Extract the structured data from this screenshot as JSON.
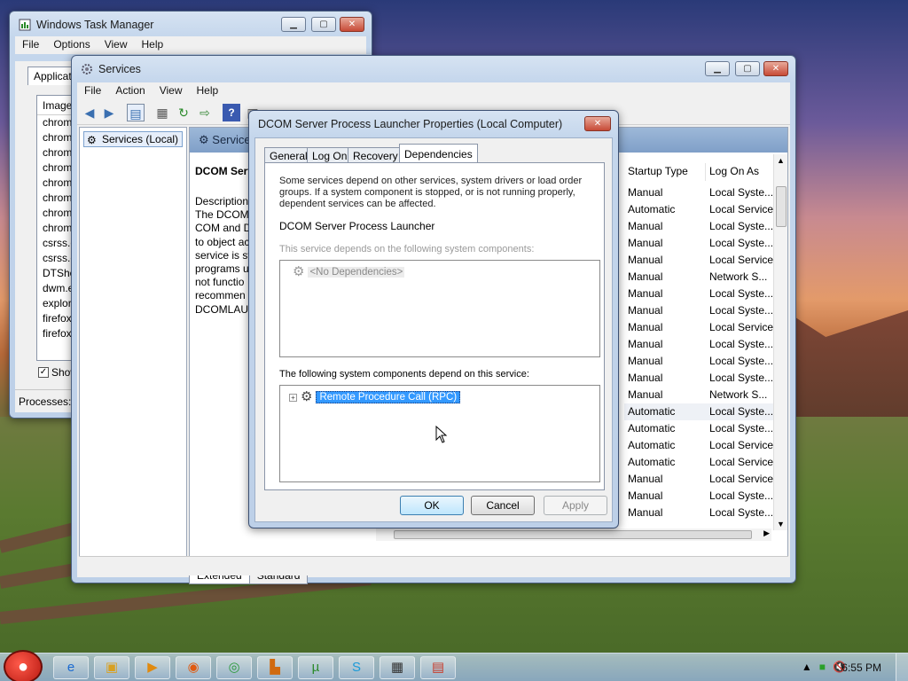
{
  "task_manager": {
    "title": "Windows Task Manager",
    "menu": [
      "File",
      "Options",
      "View",
      "Help"
    ],
    "tab": "Applicati",
    "column": "Image",
    "processes": [
      "chrome",
      "chrome",
      "chrome",
      "chrome",
      "chrome",
      "chrome",
      "chrome",
      "chrome",
      "csrss.e",
      "csrss.e",
      "DTShe",
      "dwm.e",
      "explor",
      "firefox",
      "firefox"
    ],
    "show_label": "Show",
    "status": "Processes: 6"
  },
  "services": {
    "title": "Services",
    "menu": [
      "File",
      "Action",
      "View",
      "Help"
    ],
    "tree_item": "Services (Local)",
    "pane_header": "Service",
    "desc_title": "DCOM Serv",
    "desc_lines": [
      "Description",
      "The DCOM",
      "COM and D",
      "to object ac",
      "service is st",
      "programs u",
      "not functio",
      "recommen",
      "DCOMLAU"
    ],
    "columns": {
      "startup": "Startup Type",
      "logon": "Log On As"
    },
    "rows": [
      {
        "startup": "Manual",
        "logon": "Local Syste..."
      },
      {
        "startup": "Automatic",
        "logon": "Local Service"
      },
      {
        "startup": "Manual",
        "logon": "Local Syste..."
      },
      {
        "startup": "Manual",
        "logon": "Local Syste..."
      },
      {
        "startup": "Manual",
        "logon": "Local Service"
      },
      {
        "startup": "Manual",
        "logon": "Network S..."
      },
      {
        "startup": "Manual",
        "logon": "Local Syste..."
      },
      {
        "startup": "Manual",
        "logon": "Local Syste..."
      },
      {
        "startup": "Manual",
        "logon": "Local Service"
      },
      {
        "startup": "Manual",
        "logon": "Local Syste..."
      },
      {
        "startup": "Manual",
        "logon": "Local Syste..."
      },
      {
        "startup": "Manual",
        "logon": "Local Syste..."
      },
      {
        "startup": "Manual",
        "logon": "Network S..."
      },
      {
        "startup": "Automatic",
        "logon": "Local Syste..."
      },
      {
        "startup": "Automatic",
        "logon": "Local Syste..."
      },
      {
        "startup": "Automatic",
        "logon": "Local Service"
      },
      {
        "startup": "Automatic",
        "logon": "Local Service"
      },
      {
        "startup": "Manual",
        "logon": "Local Service"
      },
      {
        "startup": "Manual",
        "logon": "Local Syste..."
      },
      {
        "startup": "Manual",
        "logon": "Local Syste..."
      }
    ],
    "view_tabs": [
      "Extended",
      "Standard"
    ]
  },
  "dialog": {
    "title": "DCOM Server Process Launcher Properties (Local Computer)",
    "tabs": [
      "General",
      "Log On",
      "Recovery",
      "Dependencies"
    ],
    "intro": "Some services depend on other services, system drivers or load order groups. If a system component is stopped, or is not running properly, dependent services can be affected.",
    "service_name": "DCOM Server Process Launcher",
    "depends_on_label": "This service depends on the following system components:",
    "no_dependencies": "<No Dependencies>",
    "dependents_label": "The following system components depend on this service:",
    "dependent_item": "Remote Procedure Call (RPC)",
    "ok": "OK",
    "cancel": "Cancel",
    "apply": "Apply"
  },
  "taskbar": {
    "clock": "6:55 PM"
  },
  "colors": {
    "selection": "#3399ff",
    "title_bar": "#c4d6ec",
    "close_button": "#c74a36"
  }
}
